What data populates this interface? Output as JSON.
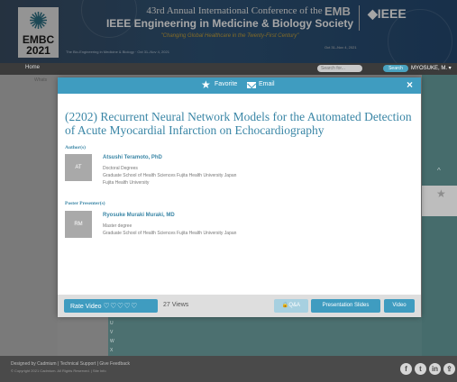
{
  "banner": {
    "logo_text": "EMBC",
    "logo_year": "2021",
    "small_text": "The Bio-Engineering in Medicine & Biology · Oct 31–Nov 4, 2021",
    "title_line1": "43rd Annual International Conference of the",
    "title_line2": "IEEE Engineering in Medicine & Biology Society",
    "tagline": "\"Changing Global Healthcare in the Twenty-First Century\"",
    "emb": "EMB",
    "ieee": "◆IEEE",
    "dates": "Oct 31–Nov 4, 2021"
  },
  "nav": {
    "home": "Home",
    "search_placeholder": "Search for...",
    "search_button": "Search",
    "user": "MYOSUKE, M. ▾"
  },
  "page": {
    "left_label": "Whats",
    "right_chevron": "^",
    "right_star": "★",
    "letters": [
      "U",
      "V",
      "W",
      "X"
    ]
  },
  "modal": {
    "favorite": "Favorite",
    "email": "Email",
    "close": "×",
    "title": "(2202) Recurrent Neural Network Models for the Automated Detection of Acute Myocardial Infarction on Echocardiography",
    "authors_label": "Author(s)",
    "author": {
      "initials": "AT",
      "name": "Atsushi Teramoto, PhD",
      "degree": "Doctoral Degrees",
      "affiliation": "Graduate School of Health Sciences Fujita Health University Japan",
      "org": "Fujita Health University"
    },
    "presenter_label": "Poster Presenter(s)",
    "presenter": {
      "initials": "RM",
      "name": "Ryosuke Muraki Muraki, MD",
      "degree": "Master degree",
      "affiliation": "Graduate School of Health Sciences Fujita Health University Japan"
    },
    "footer": {
      "rate_label": "Rate Video",
      "rate_hearts": "♡♡♡♡♡",
      "views": "27 Views",
      "qa": "🔒Q&A",
      "slides": "Presentation Slides",
      "video": "Video"
    }
  },
  "footer": {
    "links": "Designed by Cadmium  |  Technical Support  |  Give Feedback",
    "copyright": "© Copyright 2021 Cadmium. All Rights Reserved.  |  Site Info"
  },
  "colors": {
    "accent": "#3f9cc0",
    "title": "#3a86a6"
  },
  "icons": [
    "star-icon",
    "mail-icon",
    "close-icon",
    "heart-icon",
    "lock-icon",
    "facebook-icon",
    "twitter-icon",
    "linkedin-icon",
    "share-icon"
  ]
}
